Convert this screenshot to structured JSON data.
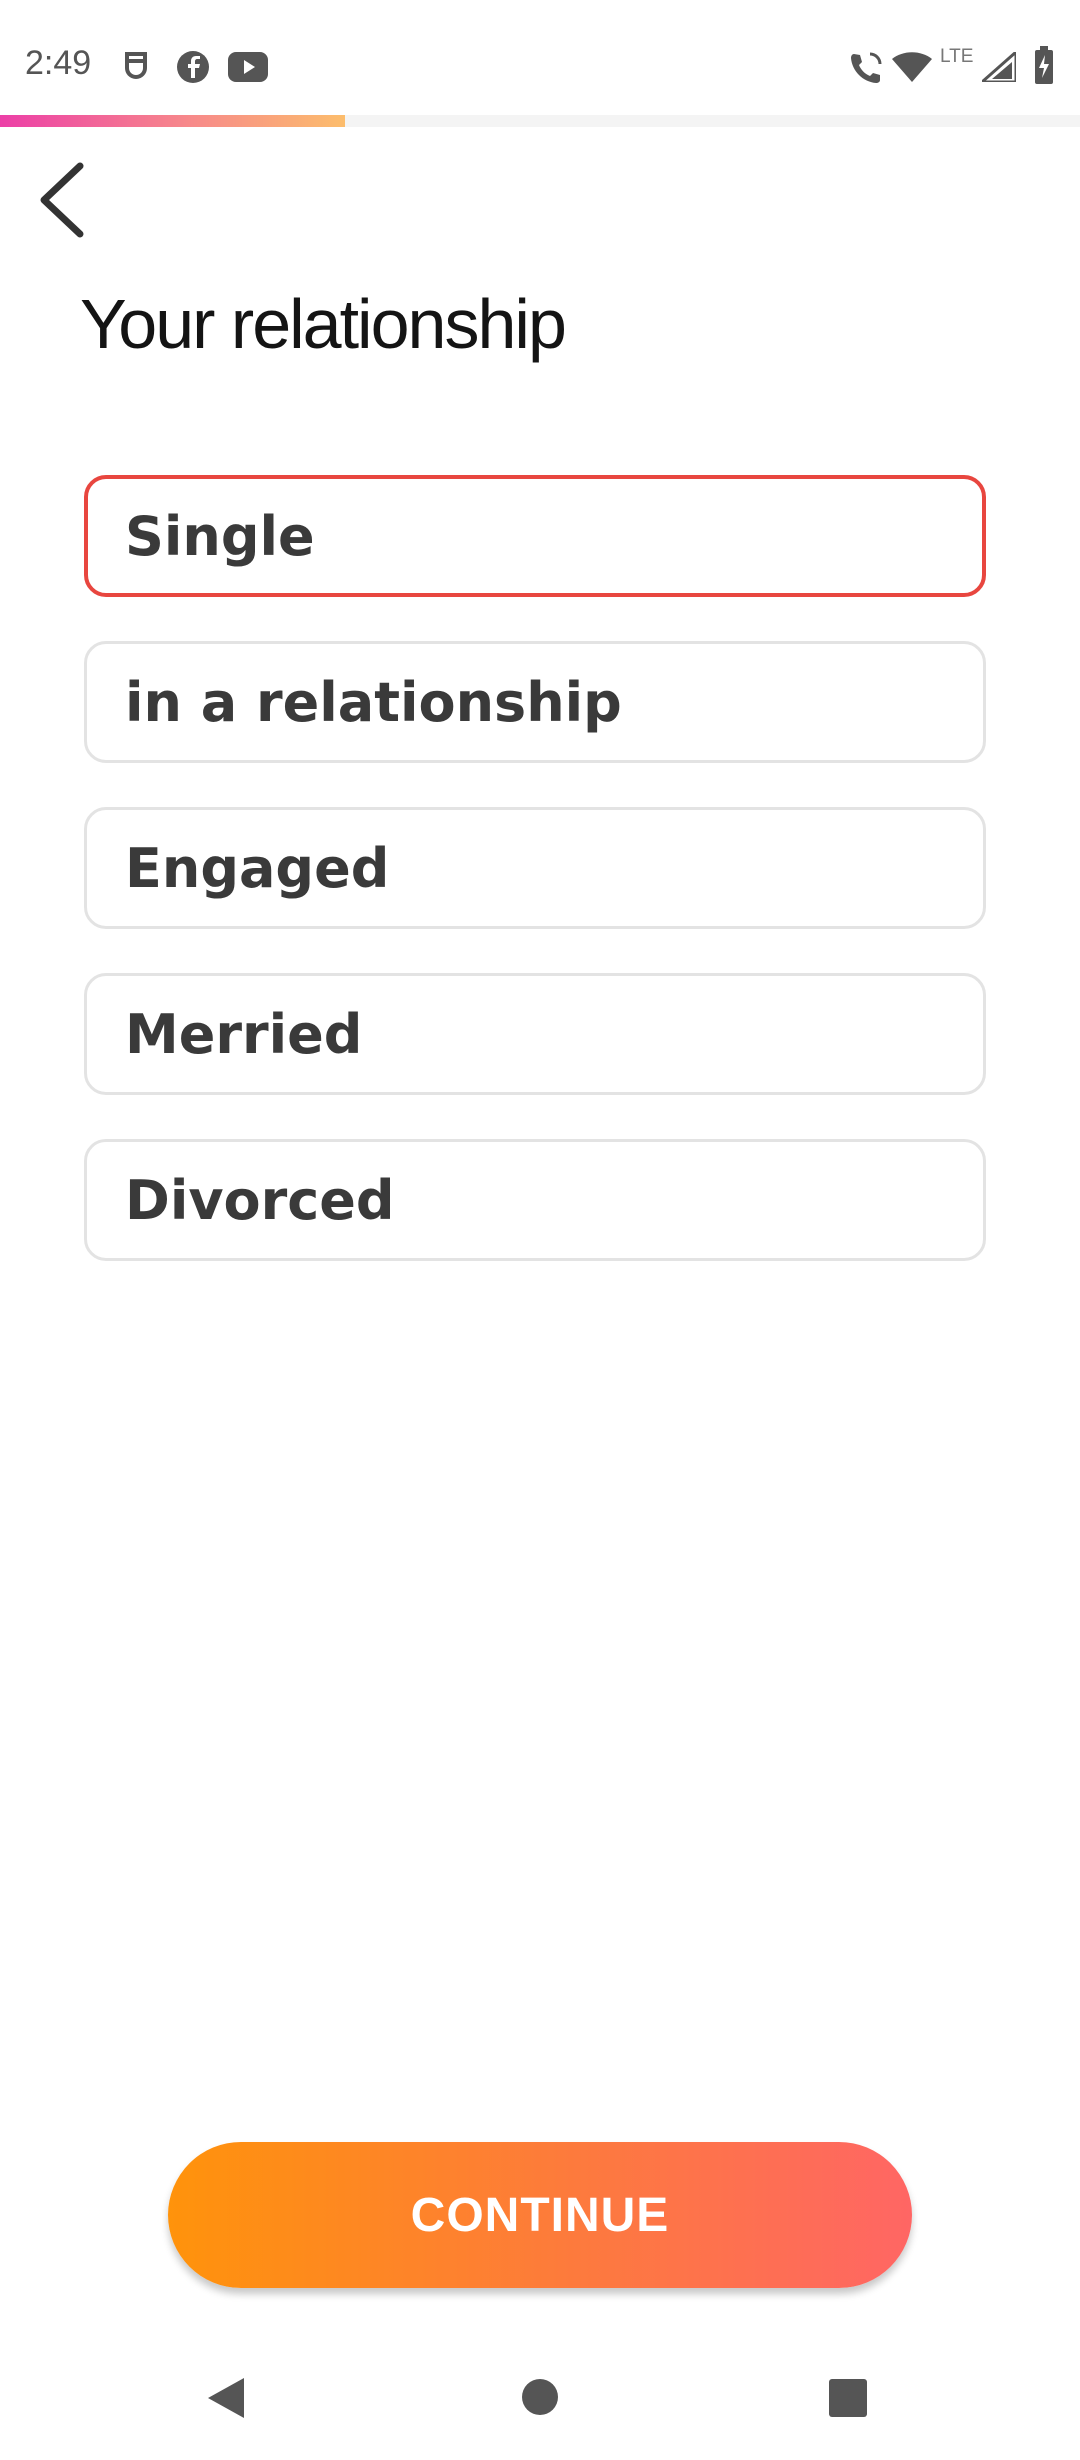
{
  "status_bar": {
    "time": "2:49",
    "network": "LTE",
    "left_icons": [
      "notification-icon",
      "facebook-icon",
      "youtube-icon"
    ],
    "right_icons": [
      "wifi-calling-icon",
      "wifi-icon",
      "signal-icon",
      "battery-charging-icon"
    ]
  },
  "progress": {
    "fraction": 0.319
  },
  "colors": {
    "progress_gradient": [
      "#ec3fa7",
      "#fcbd6c"
    ],
    "selected_border": "#e8463f",
    "button_gradient": [
      "#ff930b",
      "#ff6664"
    ]
  },
  "header": {
    "back_icon": "chevron-left-icon"
  },
  "page": {
    "title": "Your relationship"
  },
  "options": [
    {
      "label": "Single",
      "selected": true
    },
    {
      "label": "in a relationship",
      "selected": false
    },
    {
      "label": "Engaged",
      "selected": false
    },
    {
      "label": "Merried",
      "selected": false
    },
    {
      "label": "Divorced",
      "selected": false
    }
  ],
  "footer": {
    "continue_label": "CONTINUE"
  },
  "nav_bar": {
    "icons": [
      "back-triangle-icon",
      "home-circle-icon",
      "recents-square-icon"
    ]
  }
}
